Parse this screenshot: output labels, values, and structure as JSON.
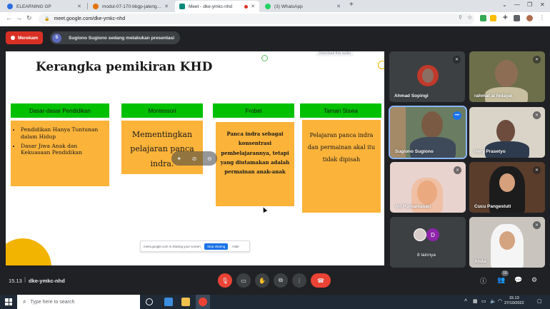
{
  "browser": {
    "tabs": [
      {
        "title": "ELEARNING GP",
        "fav_color": "#2d6cdf"
      },
      {
        "title": "modul-07-170-bbgp-jateng: 1.3.",
        "fav_color": "#e37400"
      },
      {
        "title": "Meet - dke-ymkc-nhd",
        "fav_color": "#00897b"
      },
      {
        "title": "(3) WhatsApp",
        "fav_color": "#25d366"
      }
    ],
    "url": "meet.google.com/dke-ymkc-nhd"
  },
  "meet": {
    "recording_label": "Merekam",
    "presenter_initial": "S",
    "presenting_text": "Sugiono Sugiono sedang melakukan presentasi",
    "download_audio": "Download this audio",
    "share_bar": {
      "text": "meet.google.com is sharing your screen.",
      "stop": "Stop sharing",
      "hide": "Hide"
    }
  },
  "slide": {
    "title": "Kerangka pemikiran KHD",
    "columns": [
      {
        "header": "Dasar-dasar Pendidikan",
        "items": [
          "Pendidikan Hanya Tuntunan dalam Hidup",
          "Dasar Jiwa Anak dan Kekuasaan Pendidikan"
        ]
      },
      {
        "header": "Montessori",
        "text": "Mementingkan pelajaran panca indra."
      },
      {
        "header": "Frobel",
        "text": "Panca indra sebagai konsentrasi pembelajarannya, tetapi yang diutamakan adalah permainan anak-anak"
      },
      {
        "header": "Taman Siswa",
        "text": "Pelajaran panca indra dan permainan akal itu tidak dipisah"
      }
    ]
  },
  "participants": [
    {
      "name": "Ahmad Sopingi",
      "muted": true
    },
    {
      "name": "rahmat al hidayat",
      "muted": true
    },
    {
      "name": "Sugiono Sugiono",
      "muted": false
    },
    {
      "name": "Hery Prasetyo",
      "muted": true
    },
    {
      "name": "Ari Purnamasari",
      "muted": true
    },
    {
      "name": "Cucu Pangestuti",
      "muted": true
    },
    {
      "name": "8 lainnya",
      "muted": false,
      "initial": "D"
    },
    {
      "name": "Anda",
      "muted": true
    }
  ],
  "callbar": {
    "time": "15.13",
    "meeting_code": "dke-ymkc-nhd",
    "participant_count": "16"
  },
  "taskbar": {
    "search_placeholder": "Type here to search",
    "time": "15.13",
    "date": "27/10/2022"
  },
  "colors": {
    "recording_red": "#d93025",
    "column_header_green": "#00c000",
    "column_box_orange": "#fbb33a",
    "end_call_red": "#ea4335",
    "speaking_outline": "#8ab4f8"
  }
}
